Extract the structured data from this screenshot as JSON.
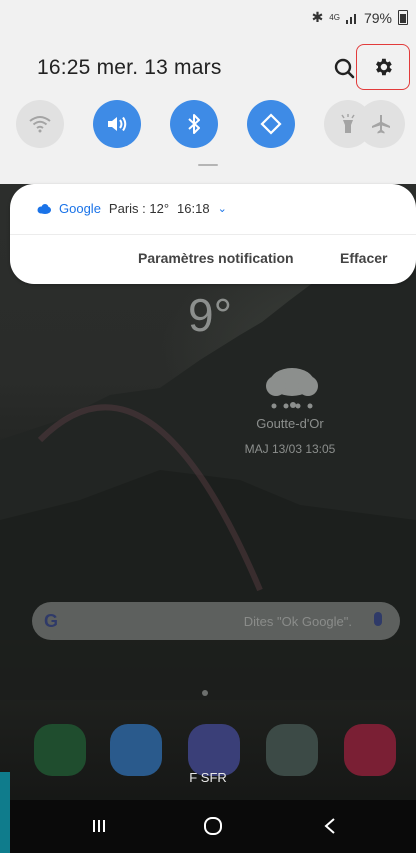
{
  "status_bar": {
    "network": "4G",
    "battery_percent": "79%",
    "icons": [
      "bluetooth-icon",
      "network-4g-icon",
      "signal-icon",
      "battery-icon"
    ]
  },
  "quick_panel": {
    "clock": "16:25  mer. 13 mars",
    "tiles": [
      {
        "name": "wifi",
        "icon": "wifi-icon",
        "active": false
      },
      {
        "name": "sound",
        "icon": "sound-icon",
        "active": true
      },
      {
        "name": "bluetooth",
        "icon": "bluetooth-icon",
        "active": true
      },
      {
        "name": "auto-rotate",
        "icon": "auto-rotate-icon",
        "active": true
      },
      {
        "name": "flashlight",
        "icon": "flashlight-icon",
        "active": false
      },
      {
        "name": "airplane-mode",
        "icon": "airplane-icon",
        "active": false
      }
    ],
    "accent_color": "#3e8be6",
    "highlight_color": "#e23b3b"
  },
  "notification": {
    "app": "Google",
    "text": "Paris : 12°",
    "time": "16:18",
    "settings_label": "Paramètres notification",
    "clear_label": "Effacer"
  },
  "background": {
    "temperature": "9°",
    "location": "Goutte-d'Or",
    "updated": "MAJ 13/03 13:05",
    "search_hint": "Dites \"Ok Google\".",
    "dock_label": "F SFR",
    "dock_apps": [
      "phone-icon",
      "messages-icon",
      "internet-icon",
      "play-store-icon",
      "camera-icon"
    ]
  }
}
